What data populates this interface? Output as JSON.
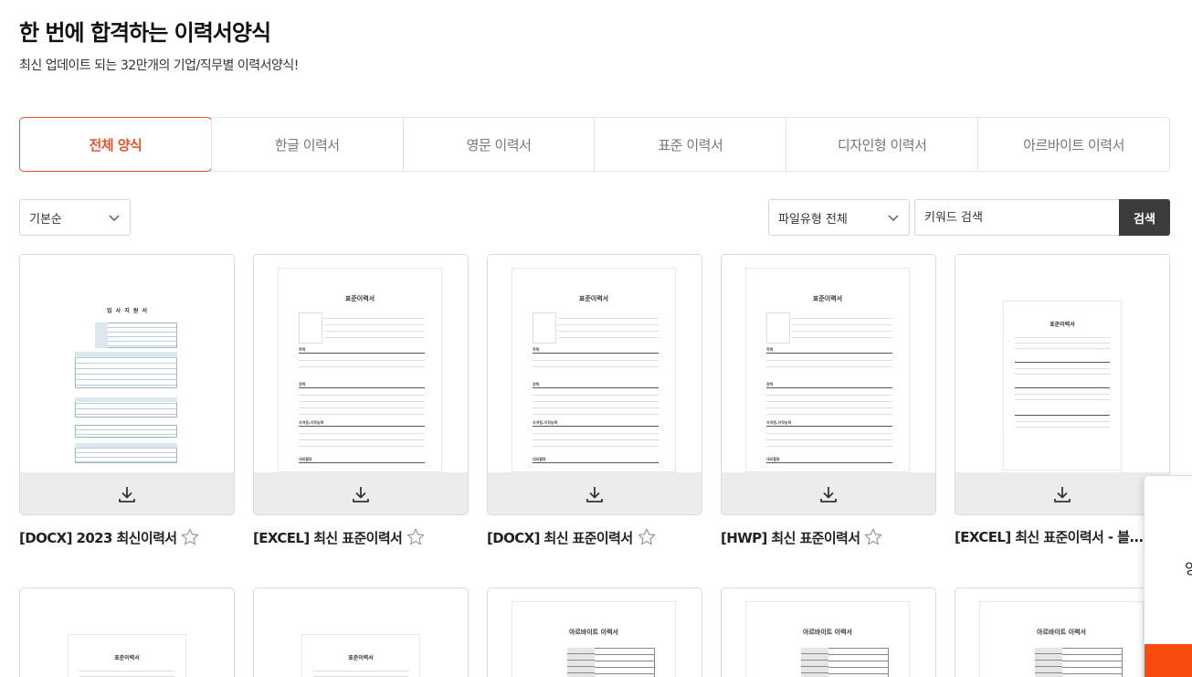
{
  "header": {
    "title": "한 번에 합격하는 이력서양식",
    "subtitle": "최신 업데이트 되는 32만개의 기업/직무별 이력서양식!"
  },
  "tabs": [
    {
      "label": "전체 양식",
      "active": true
    },
    {
      "label": "한글 이력서",
      "active": false
    },
    {
      "label": "영문 이력서",
      "active": false
    },
    {
      "label": "표준 이력서",
      "active": false
    },
    {
      "label": "디자인형 이력서",
      "active": false
    },
    {
      "label": "아르바이트 이력서",
      "active": false
    }
  ],
  "filters": {
    "sort": {
      "selected": "기본순"
    },
    "file_type": {
      "selected": "파일유형 전체"
    },
    "search": {
      "placeholder": "키워드 검색",
      "button": "검색"
    }
  },
  "cards": [
    {
      "title": "[DOCX] 2023 최신이력서",
      "thumb_title": "입 사 지 원 서"
    },
    {
      "title": "[EXCEL] 최신 표준이력서",
      "thumb_title": "표준이력서"
    },
    {
      "title": "[DOCX] 최신 표준이력서",
      "thumb_title": "표준이력서"
    },
    {
      "title": "[HWP] 최신 표준이력서",
      "thumb_title": "표준이력서"
    },
    {
      "title": "[EXCEL] 최신 표준이력서 - 블...",
      "thumb_title": "표준이력서"
    }
  ],
  "cards_row2": [
    {
      "thumb_title": "표준이력서"
    },
    {
      "thumb_title": "표준이력서"
    },
    {
      "thumb_title": "아르바이트 이력서"
    },
    {
      "thumb_title": "아르바이트 이력서"
    },
    {
      "thumb_title": "아르바이트 이력서"
    }
  ],
  "side_panel": {
    "text": "양"
  },
  "colors": {
    "accent": "#e4572e",
    "search_button": "#3c3c3c",
    "side_button": "#fa4c0f"
  }
}
